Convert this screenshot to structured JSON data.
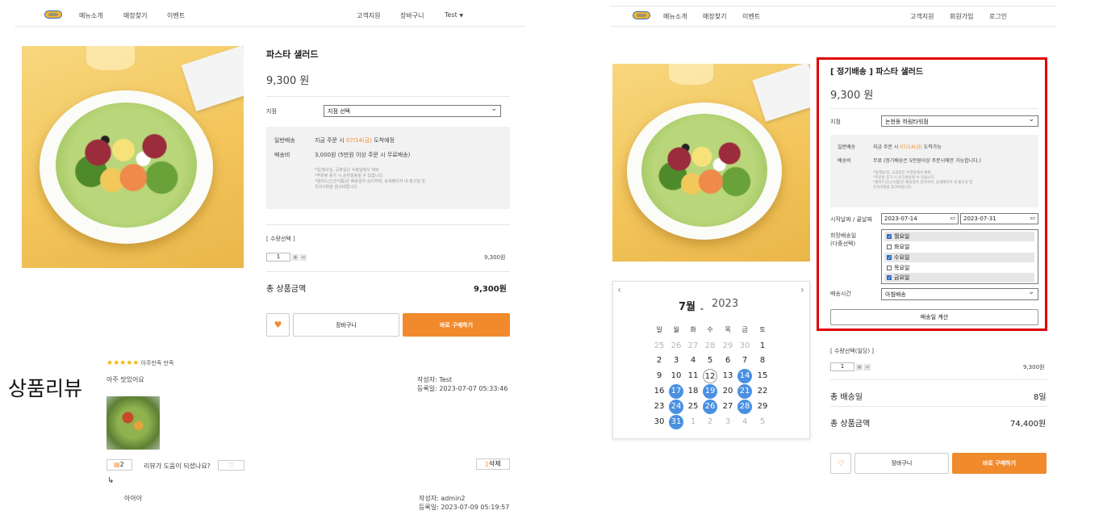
{
  "left": {
    "nav": {
      "menu": "메뉴소개",
      "store": "매장찾기",
      "event": "이벤트",
      "support": "고객지원",
      "cart": "장바구니",
      "user": "Test"
    },
    "product": {
      "title": "파스타 샐러드",
      "price": "9,300 원",
      "branch_label": "지점",
      "branch_value": "지점 선택",
      "delivery_label": "일반배송",
      "delivery_text_pre": "지금 주문 시",
      "delivery_date": "07/14(금)",
      "delivery_text_post": "도착예정",
      "fee_label": "배송비",
      "fee_text": "3,000원 (5만원 이상 주문 시 무료배송)",
      "notes": [
        "*일/월요일, 공휴일은 수령일에서 제외",
        "*주문량 증가 시 순차발송될 수 있습니다.",
        "*샐러드(신선식품)은 배송일자 상이하며, 상세페이지 내 출고일 및",
        "유의사항을 참고바랍니다."
      ],
      "qty_label": "[ 수량선택 ]",
      "qty_value": "1",
      "qty_plus": "+",
      "qty_minus": "−",
      "line_price": "9,300원",
      "total_label": "총 상품금액",
      "total_value": "9,300원",
      "cart_btn": "장바구니",
      "buy_btn": "바로 구매하기"
    },
    "review_heading": "상품리뷰",
    "review": {
      "stars": "★★★★★",
      "rating_text": "아주만족 만족",
      "text": "아주 맛있어요",
      "author": "작성자: Test",
      "date": "등록일: 2023-07-07 05:33:46",
      "comment_count": "2",
      "helpful_q": "리뷰가 도움이 되셨나요?",
      "delete_btn": "삭제",
      "reply_arrow": "↳",
      "reply_text": "아아아",
      "reply_author": "작성자: admin2",
      "reply_date": "등록일: 2023-07-09 05:19:57"
    }
  },
  "right": {
    "nav": {
      "menu": "메뉴소개",
      "store": "매장찾기",
      "event": "이벤트",
      "support": "고객지원",
      "signup": "회원가입",
      "login": "로그인"
    },
    "product": {
      "title": "[ 정기배송 ] 파스타 샐러드",
      "price": "9,300 원",
      "branch_label": "지점",
      "branch_value": "논현동 하림타워점",
      "delivery_label": "일반배송",
      "delivery_text_pre": "지금 주문 시",
      "delivery_date": "07/14(금)",
      "delivery_text_post": "도착가능",
      "fee_label": "배송비",
      "fee_text": "무료 (정기배송은 5만원이상 주문시에만 가능합니다.)",
      "notes": [
        "*일/월요일, 공휴일은 수령일에서 제외",
        "*주문량 증가 시 순차발송될 수 있습니다.",
        "*샐러드(신선식품)은 배송일자 상이하며, 상세페이지 내 출고일 및",
        "유의사항을 참고바랍니다."
      ],
      "date_label": "시작날짜 / 끝날짜",
      "start_date": "2023-07-14",
      "end_date": "2023-07-31",
      "days_label_1": "희망배송일",
      "days_label_2": "(다중선택)",
      "days": [
        {
          "label": "월요일",
          "checked": true
        },
        {
          "label": "화요일",
          "checked": false
        },
        {
          "label": "수요일",
          "checked": true
        },
        {
          "label": "목요일",
          "checked": false
        },
        {
          "label": "금요일",
          "checked": true
        }
      ],
      "time_label": "배송시간",
      "time_value": "아침배송",
      "calc_btn": "배송일 계산",
      "qty_label": "[ 수량선택(일당) ]",
      "qty_value": "1",
      "qty_plus": "+",
      "qty_minus": "−",
      "line_price": "9,300원",
      "days_total_label": "총 배송일",
      "days_total_value": "8일",
      "total_label": "총 상품금액",
      "total_value": "74,400원",
      "cart_btn": "장바구니",
      "buy_btn": "바로 구매하기"
    },
    "calendar": {
      "prev": "‹",
      "next": "›",
      "month": "7월",
      "year": "2023",
      "weekdays": [
        "일",
        "월",
        "화",
        "수",
        "목",
        "금",
        "토"
      ],
      "weeks": [
        [
          "25",
          "26",
          "27",
          "28",
          "29",
          "30",
          "1"
        ],
        [
          "2",
          "3",
          "4",
          "5",
          "6",
          "7",
          "8"
        ],
        [
          "9",
          "10",
          "11",
          "12",
          "13",
          "14",
          "15"
        ],
        [
          "16",
          "17",
          "18",
          "19",
          "20",
          "21",
          "22"
        ],
        [
          "23",
          "24",
          "25",
          "26",
          "27",
          "28",
          "29"
        ],
        [
          "30",
          "31",
          "1",
          "2",
          "3",
          "4",
          "5"
        ]
      ],
      "highlighted": [
        "14",
        "17",
        "19",
        "21",
        "24",
        "26",
        "28",
        "31"
      ],
      "today": "12",
      "highlight_color": "#4a90e2"
    }
  },
  "colors": {
    "accent": "#f08a2c",
    "highlight_border": "#e00000",
    "star": "#f5b300"
  }
}
